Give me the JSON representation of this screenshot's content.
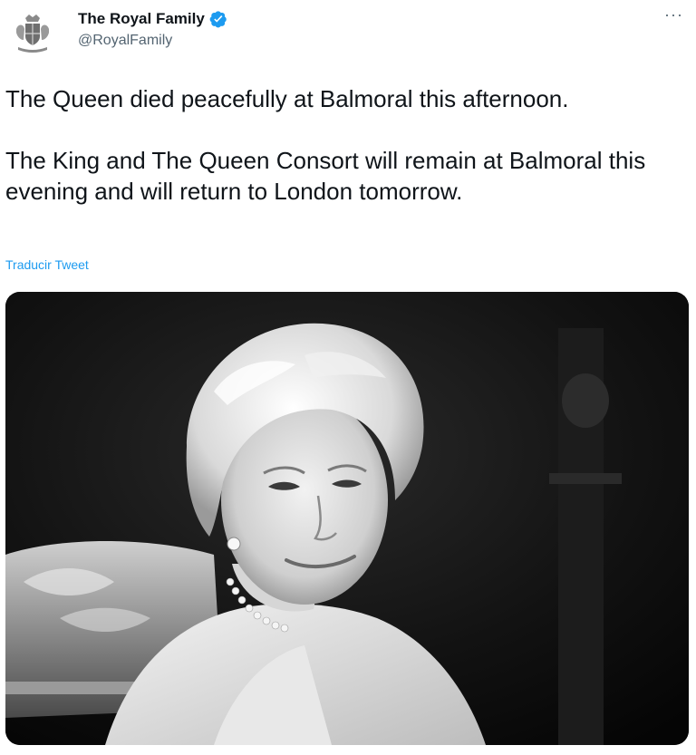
{
  "account": {
    "display_name": "The Royal Family",
    "handle": "@RoyalFamily",
    "verified": true
  },
  "tweet": {
    "paragraphs": [
      "The Queen died peacefully at Balmoral this afternoon.",
      "The King and The Queen Consort will remain at Balmoral this evening and will return to London tomorrow."
    ],
    "translate_link": "Traducir Tweet"
  },
  "menu": {
    "more_label": "···"
  },
  "media": {
    "kind": "black-and-white portrait photo"
  },
  "colors": {
    "link": "#1d9bf0",
    "verified": "#1d9bf0",
    "secondary_text": "#536471"
  }
}
